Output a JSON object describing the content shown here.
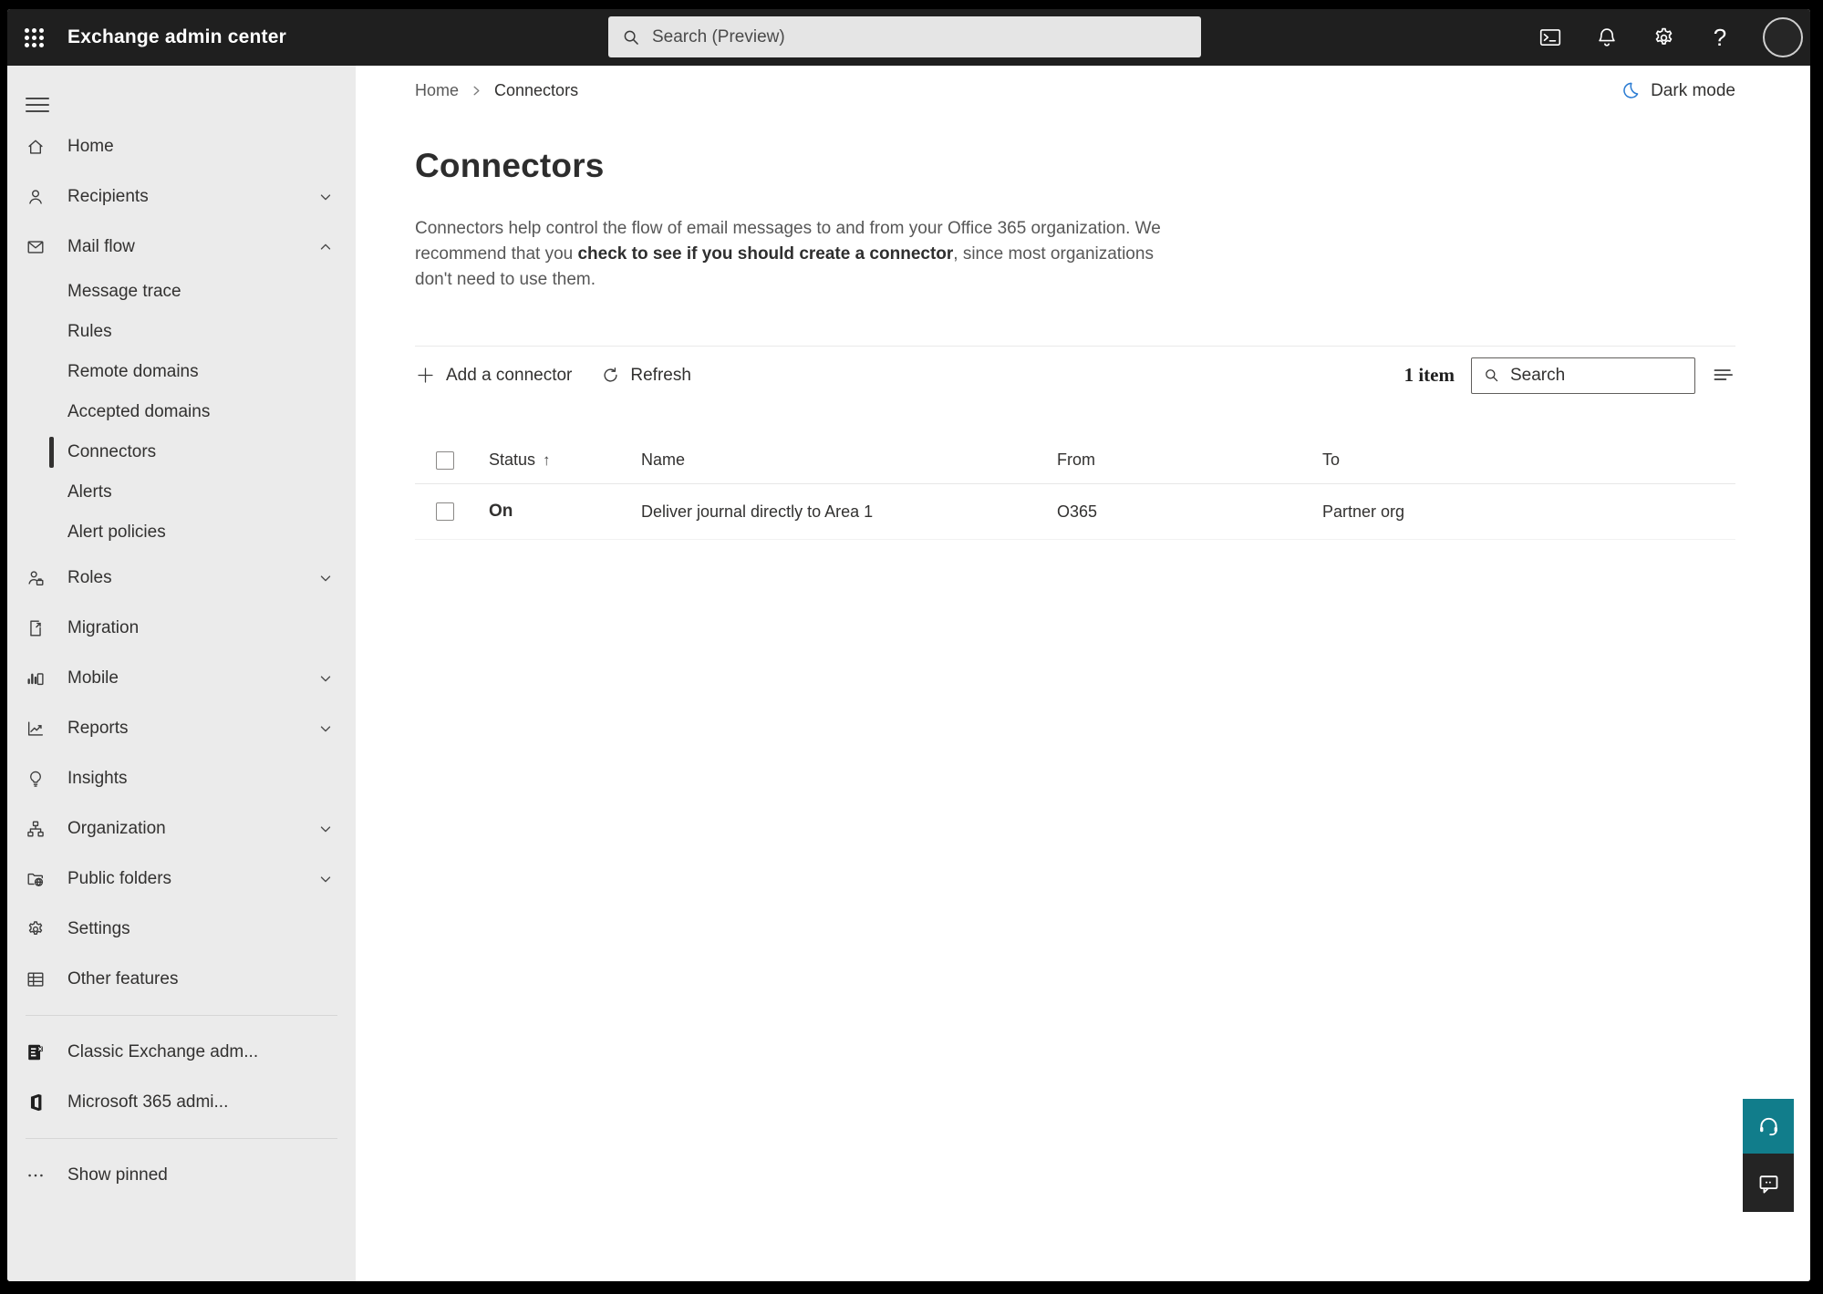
{
  "topbar": {
    "title": "Exchange admin center",
    "search_placeholder": "Search (Preview)"
  },
  "breadcrumb": {
    "home": "Home",
    "current": "Connectors"
  },
  "dark_mode": {
    "label": "Dark mode"
  },
  "page": {
    "title": "Connectors",
    "desc_1": "Connectors help control the flow of email messages to and from your Office 365 organization. We recommend that you ",
    "desc_link": "check to see if you should create a connector",
    "desc_2": ", since most organizations don't need to use them."
  },
  "toolbar": {
    "add_label": "Add a connector",
    "refresh_label": "Refresh",
    "item_count": "1 item",
    "search_placeholder": "Search"
  },
  "table": {
    "headers": {
      "status": "Status",
      "name": "Name",
      "from": "From",
      "to": "To"
    },
    "sort_arrow": "↑",
    "rows": [
      {
        "status": "On",
        "name": "Deliver journal directly to Area 1",
        "from": "O365",
        "to": "Partner org"
      }
    ]
  },
  "sidebar": {
    "items": [
      {
        "label": "Home"
      },
      {
        "label": "Recipients"
      },
      {
        "label": "Mail flow"
      },
      {
        "label": "Message trace"
      },
      {
        "label": "Rules"
      },
      {
        "label": "Remote domains"
      },
      {
        "label": "Accepted domains"
      },
      {
        "label": "Connectors",
        "selected": true
      },
      {
        "label": "Alerts"
      },
      {
        "label": "Alert policies"
      },
      {
        "label": "Roles"
      },
      {
        "label": "Migration"
      },
      {
        "label": "Mobile"
      },
      {
        "label": "Reports"
      },
      {
        "label": "Insights"
      },
      {
        "label": "Organization"
      },
      {
        "label": "Public folders"
      },
      {
        "label": "Settings"
      },
      {
        "label": "Other features"
      },
      {
        "label": "Classic Exchange adm..."
      },
      {
        "label": "Microsoft 365 admi..."
      },
      {
        "label": "Show pinned"
      }
    ]
  },
  "colors": {
    "topbar_bg": "#1f1f1f",
    "sidebar_bg": "#ebebeb",
    "accent_blue": "#2b7cd3",
    "support_teal": "#117d8b"
  }
}
